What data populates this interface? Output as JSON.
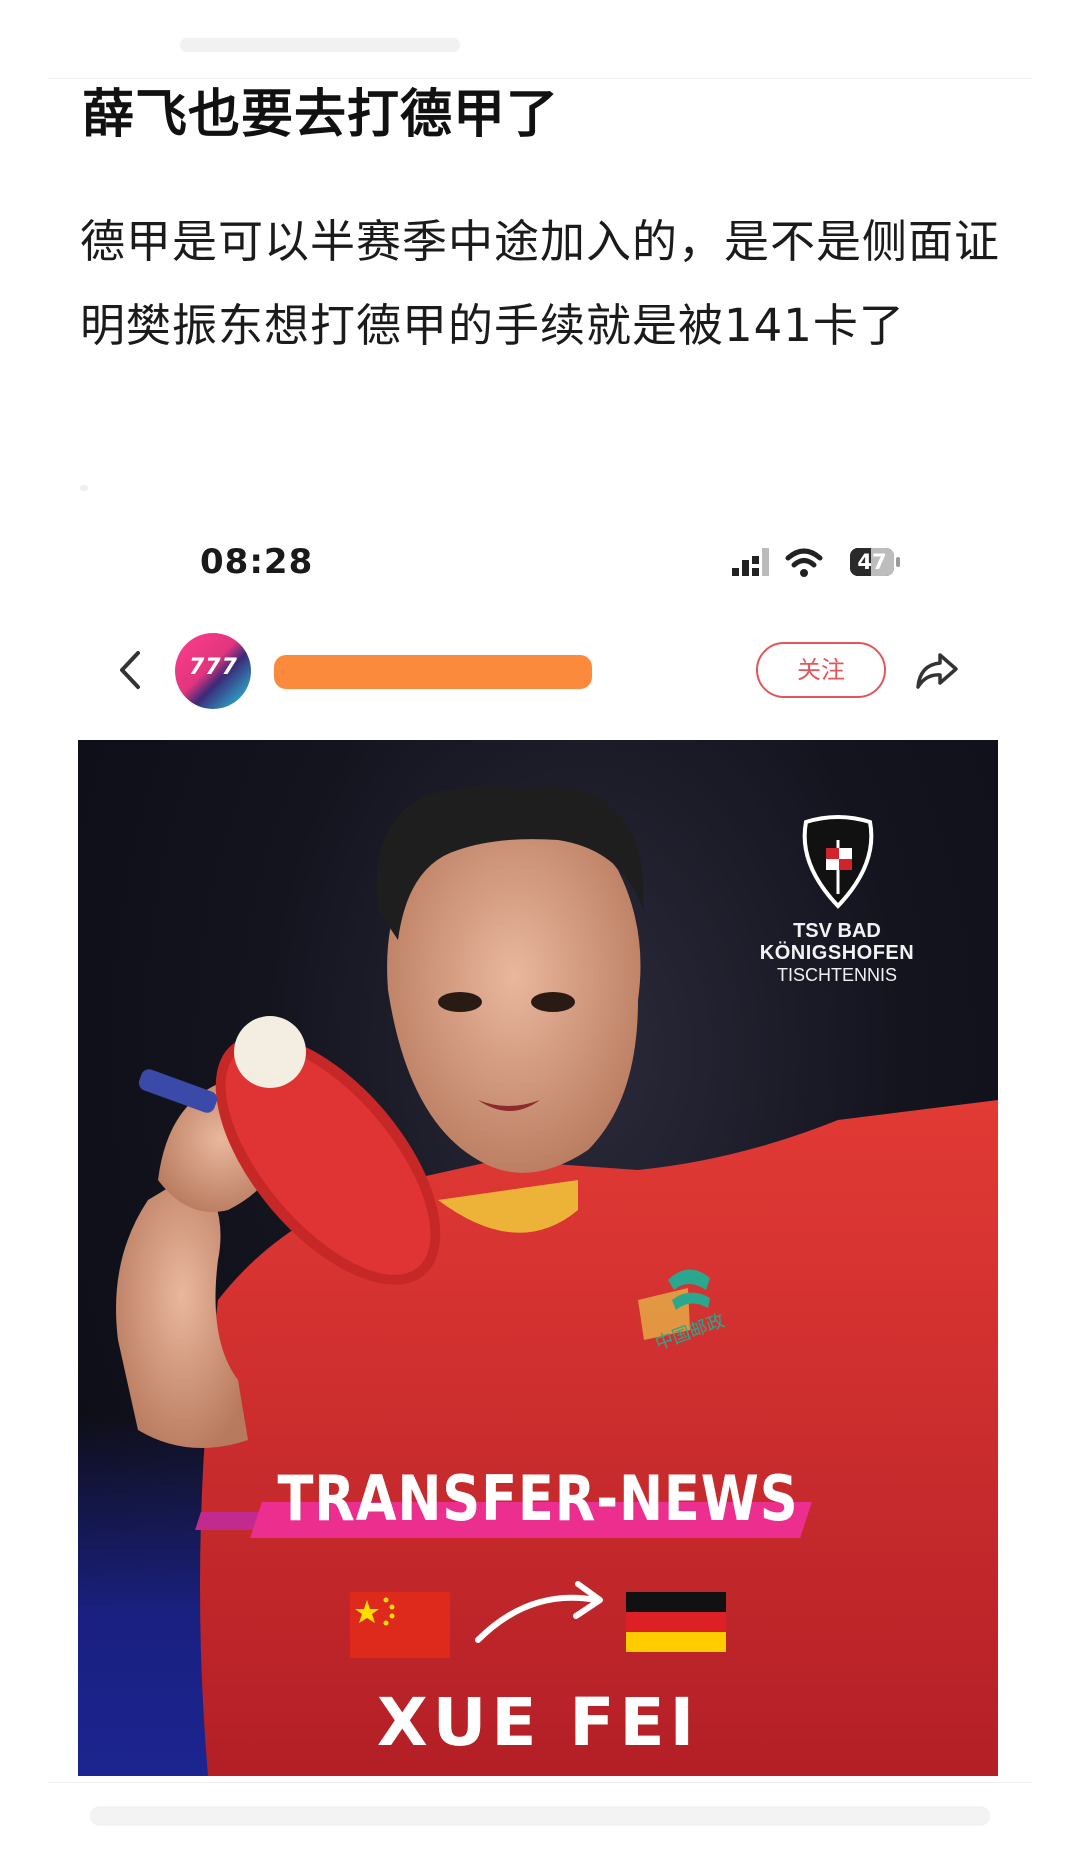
{
  "post": {
    "title": "薛飞也要去打德甲了",
    "body": "德甲是可以半赛季中途加入的，是不是侧面证明樊振东想打德甲的手续就是被141卡了"
  },
  "embedded_screenshot": {
    "status_bar": {
      "time": "08:28",
      "battery": "47",
      "battery_level": 0.47
    },
    "nav": {
      "back_icon": "chevron-left-icon",
      "avatar_mark": "777",
      "follow_label": "关注",
      "share_icon": "share-arrow-icon"
    },
    "poster": {
      "club": {
        "line1": "TSV BAD",
        "line2": "KÖNIGSHOFEN",
        "line3": "TISCHTENNIS"
      },
      "headline": "TRANSFER-NEWS",
      "from_flag": "china-flag",
      "to_flag": "germany-flag",
      "player_name": "XUE FEI",
      "shirt_badge": "中国邮政",
      "colors": {
        "stripe": "#ec2f8f",
        "shirt": "#d42a2a",
        "background": "#0b0b14",
        "bottom": "#1c2490"
      }
    }
  }
}
